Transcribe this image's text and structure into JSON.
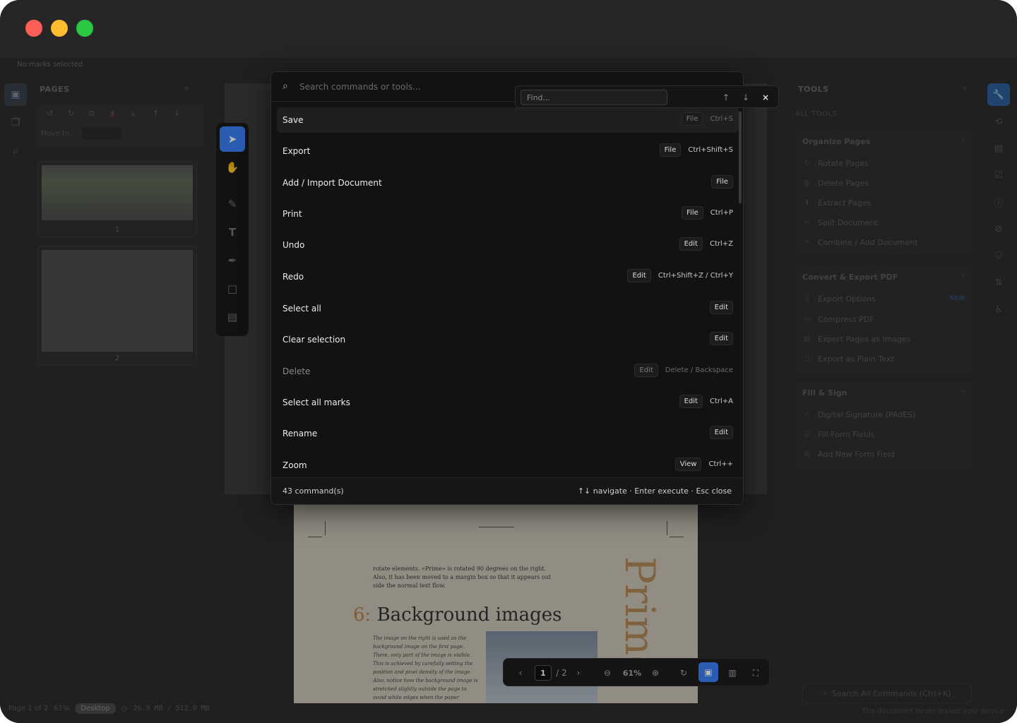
{
  "window": {
    "traffic_lights": [
      "close",
      "minimize",
      "maximize"
    ]
  },
  "app": {
    "status_top": "No marks selected",
    "pages": {
      "title": "PAGES",
      "move_to_label": "Move to...",
      "thumbnails": [
        {
          "number": "1"
        },
        {
          "number": "2"
        }
      ]
    },
    "document": {
      "intro_text": "rotate elements. «Prime» is rotated 90 degrees on the right. Also, it has been moved to a margin box so that it appears out side the normal text flow.",
      "heading_number": "6:",
      "heading": "Background images",
      "body_text": "The image on the right is used as the background image on the first page. There, only part of the image is visible. This is achieved by carefully setting the position and pixel density of the image. Also, notice how the background image is stretched slightly outside the page to avoid white edges when the paper",
      "vertical_word": "Prime"
    },
    "tools_panel": {
      "title": "TOOLS",
      "all_tools": "ALL TOOLS",
      "sections": [
        {
          "title": "Organize Pages",
          "items": [
            {
              "label": "Rotate Pages",
              "icon": "rotate-icon"
            },
            {
              "label": "Delete Pages",
              "icon": "trash-icon"
            },
            {
              "label": "Extract Pages",
              "icon": "extract-icon"
            },
            {
              "label": "Split Document",
              "icon": "scissors-icon"
            },
            {
              "label": "Combine / Add Document",
              "icon": "plus-icon"
            }
          ]
        },
        {
          "title": "Convert & Export PDF",
          "items": [
            {
              "label": "Export Options",
              "icon": "file-icon",
              "badge": "NEW"
            },
            {
              "label": "Compress PDF",
              "icon": "compress-icon"
            },
            {
              "label": "Export Pages as Images",
              "icon": "image-icon"
            },
            {
              "label": "Export as Plain Text",
              "icon": "text-file-icon"
            }
          ]
        },
        {
          "title": "Fill & Sign",
          "items": [
            {
              "label": "Digital Signature (PAdES)",
              "icon": "signature-icon"
            },
            {
              "label": "Fill Form Fields",
              "icon": "checkbox-icon"
            },
            {
              "label": "Add New Form Field",
              "icon": "add-field-icon"
            }
          ]
        }
      ],
      "search_label": "Search All Commands (Ctrl+K)"
    },
    "bottom_bar": {
      "page_info": "Page 1 of 2",
      "zoom": "61%",
      "mode": "Desktop",
      "memory": "26.9 MB / 512.0 MB",
      "privacy_note": "The document never leaves your device"
    },
    "zoom_bar": {
      "page_input": "1",
      "page_total": "/ 2",
      "zoom": "61%"
    }
  },
  "palette": {
    "search_placeholder": "Search commands or tools...",
    "commands": [
      {
        "label": "Save",
        "category": "File",
        "shortcut": "Ctrl+S",
        "state": "selected"
      },
      {
        "label": "Export",
        "category": "File",
        "shortcut": "Ctrl+Shift+S",
        "state": "normal"
      },
      {
        "label": "Add / Import Document",
        "category": "File",
        "shortcut": "",
        "state": "normal"
      },
      {
        "label": "Print",
        "category": "File",
        "shortcut": "Ctrl+P",
        "state": "normal"
      },
      {
        "label": "Undo",
        "category": "Edit",
        "shortcut": "Ctrl+Z",
        "state": "normal"
      },
      {
        "label": "Redo",
        "category": "Edit",
        "shortcut": "Ctrl+Shift+Z / Ctrl+Y",
        "state": "normal"
      },
      {
        "label": "Select all",
        "category": "Edit",
        "shortcut": "",
        "state": "normal"
      },
      {
        "label": "Clear selection",
        "category": "Edit",
        "shortcut": "",
        "state": "normal"
      },
      {
        "label": "Delete",
        "category": "Edit",
        "shortcut": "Delete / Backspace",
        "state": "disabled"
      },
      {
        "label": "Select all marks",
        "category": "Edit",
        "shortcut": "Ctrl+A",
        "state": "normal"
      },
      {
        "label": "Rename",
        "category": "Edit",
        "shortcut": "",
        "state": "normal"
      },
      {
        "label": "Zoom",
        "category": "View",
        "shortcut": "Ctrl++",
        "state": "normal"
      }
    ],
    "count": "43 command(s)",
    "hint": "↑↓ navigate · Enter execute · Esc close"
  },
  "find_bar": {
    "placeholder": "Find..."
  },
  "colors": {
    "accent": "#3b82f6",
    "palette_bg": "#121212",
    "app_bg": "#2d2d2d"
  }
}
